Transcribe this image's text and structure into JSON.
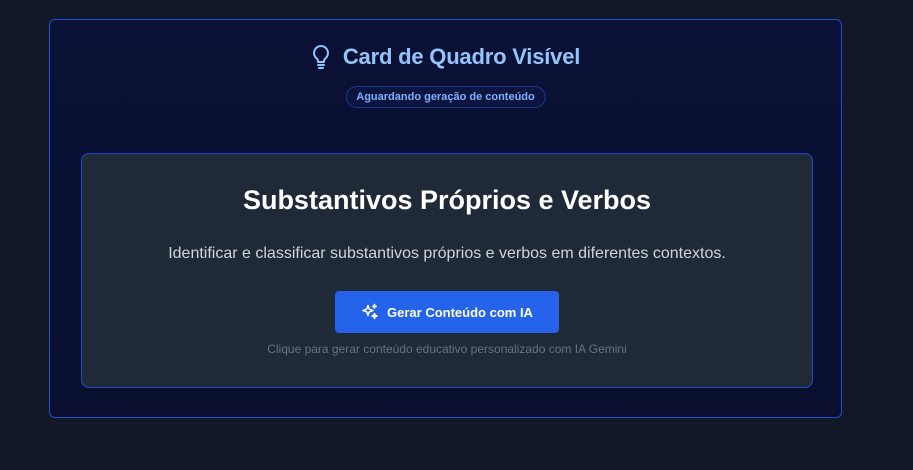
{
  "card": {
    "title": "Card de Quadro Visível",
    "status": "Aguardando geração de conteúdo",
    "icon": "lightbulb-icon"
  },
  "topic": {
    "title": "Substantivos Próprios e Verbos",
    "description": "Identificar e classificar substantivos próprios e verbos em diferentes contextos."
  },
  "action": {
    "button_label": "Gerar Conteúdo com IA",
    "button_icon": "sparkles-icon",
    "helper": "Clique para gerar conteúdo educativo personalizado com IA Gemini"
  },
  "colors": {
    "background": "#111827",
    "outer_card": "#0b1136",
    "accent_border": "#2563eb",
    "title": "#93c5fd",
    "inner_card": "#1f2937",
    "button": "#2563eb"
  }
}
